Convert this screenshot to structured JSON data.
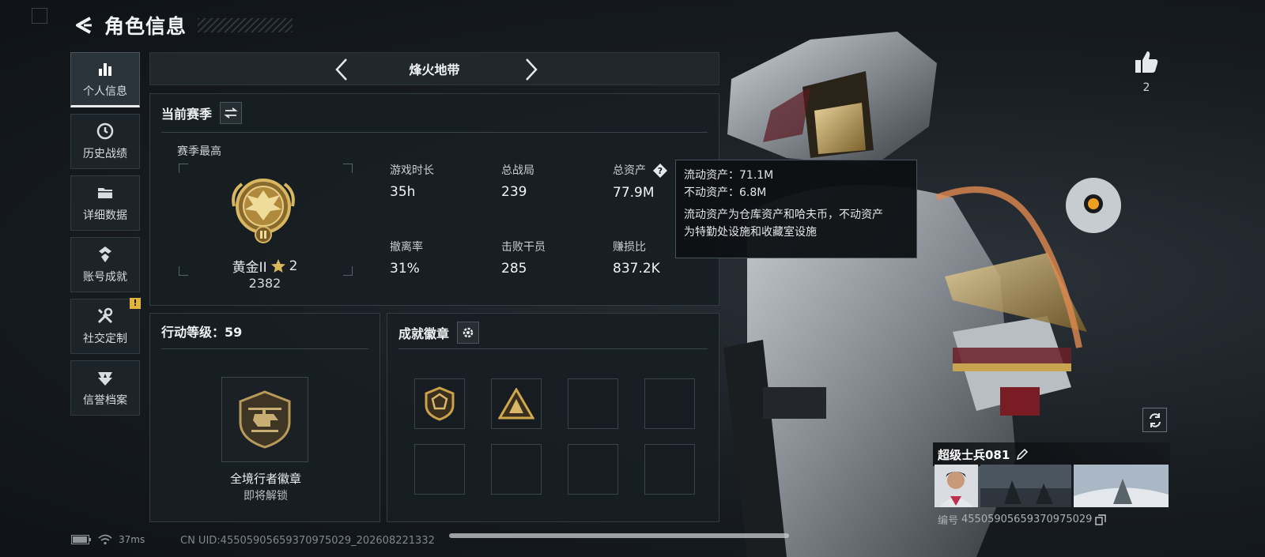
{
  "header": {
    "title": "角色信息"
  },
  "sidebar": {
    "items": [
      {
        "label": "个人信息",
        "icon": "bar-chart-icon",
        "active": true
      },
      {
        "label": "历史战绩",
        "icon": "clock-icon"
      },
      {
        "label": "详细数据",
        "icon": "folder-icon"
      },
      {
        "label": "账号成就",
        "icon": "medal-icon"
      },
      {
        "label": "社交定制",
        "icon": "tools-icon",
        "badge": "!"
      },
      {
        "label": "信誉档案",
        "icon": "shield-icon"
      }
    ]
  },
  "mode": {
    "title": "烽火地带"
  },
  "season": {
    "title": "当前赛季",
    "best_label": "赛季最高",
    "rank_name": "黄金II",
    "rank_stars": "2",
    "rank_score": "2382",
    "stats": [
      {
        "label": "游戏时长",
        "value": "35h"
      },
      {
        "label": "总战局",
        "value": "239"
      },
      {
        "label": "总资产",
        "value": "77.9M"
      },
      {
        "label": "撤离率",
        "value": "31%"
      },
      {
        "label": "击败干员",
        "value": "285"
      },
      {
        "label": "赚损比",
        "value": "837.2K"
      }
    ]
  },
  "tooltip": {
    "line1": "流动资产：71.1M",
    "line2": "不动资产：6.8M",
    "line3": "流动资产为仓库资产和哈夫币，不动资产",
    "line4": "为特勤处设施和收藏室设施"
  },
  "level": {
    "title": "行动等级：59",
    "badge_name": "全境行者徽章",
    "badge_status": "即将解锁"
  },
  "achievements": {
    "title": "成就徽章"
  },
  "profile": {
    "like_count": "2",
    "player_name": "超级士兵081",
    "id_label": "编号",
    "id_value": "455059056593709750​29"
  },
  "status": {
    "ping": "37ms",
    "cn_uid": "CN UID:455059056593709750​29_202608221332"
  },
  "colors": {
    "accent_gold": "#c9a24a",
    "badge_yellow": "#e0b43a"
  }
}
